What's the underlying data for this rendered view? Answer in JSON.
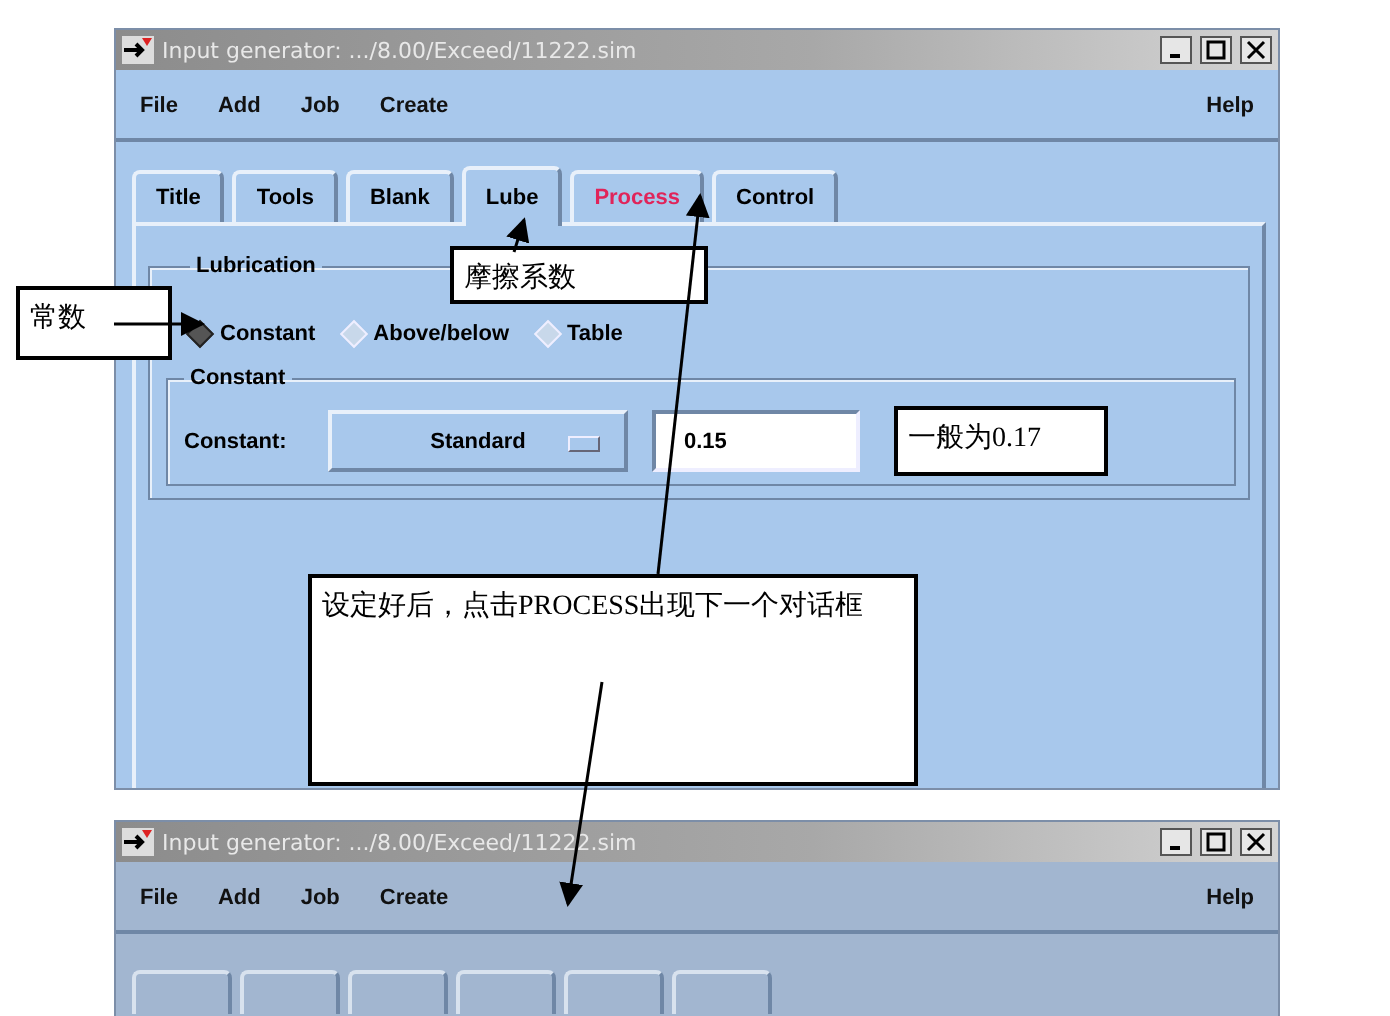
{
  "windows": [
    {
      "title": "Input generator: .../8.00/Exceed/11222.sim",
      "menu": [
        "File",
        "Add",
        "Job",
        "Create"
      ],
      "help": "Help",
      "tabs": [
        {
          "label": "Title",
          "selected": false,
          "color": "#000000"
        },
        {
          "label": "Tools",
          "selected": false,
          "color": "#000000"
        },
        {
          "label": "Blank",
          "selected": false,
          "color": "#000000"
        },
        {
          "label": "Lube",
          "selected": true,
          "color": "#000000"
        },
        {
          "label": "Process",
          "selected": false,
          "color": "#e0245a"
        },
        {
          "label": "Control",
          "selected": false,
          "color": "#000000"
        }
      ],
      "lubrication": {
        "title": "Lubrication",
        "options": [
          {
            "label": "Constant",
            "selected": true
          },
          {
            "label": "Above/below",
            "selected": false
          },
          {
            "label": "Table",
            "selected": false
          }
        ],
        "constant": {
          "title": "Constant",
          "label": "Constant:",
          "dropdown": "Standard",
          "value": "0.15"
        }
      }
    },
    {
      "title": "Input generator: .../8.00/Exceed/11222.sim",
      "menu": [
        "File",
        "Add",
        "Job",
        "Create"
      ],
      "help": "Help",
      "dimmed": true
    }
  ],
  "callouts": [
    "常数",
    "摩擦系数",
    "一般为0.17",
    "设定好后，点击PROCESS出现下一个对话框"
  ]
}
